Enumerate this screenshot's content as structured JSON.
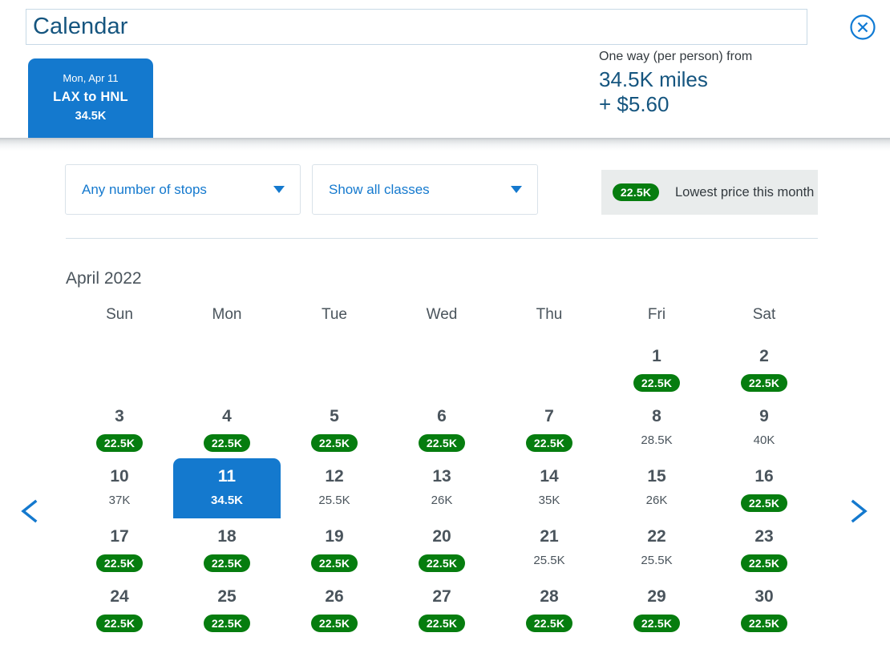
{
  "header": {
    "title": "Calendar",
    "close_icon": "close-circle-icon",
    "flight_card": {
      "date": "Mon, Apr 11",
      "route": "LAX to HNL",
      "miles": "34.5K"
    },
    "price": {
      "label": "One way (per person) from",
      "miles": "34.5K miles",
      "taxes": "+ $5.60"
    }
  },
  "filters": {
    "stops": {
      "value": "Any number of stops",
      "icon": "chevron-down-icon"
    },
    "classes": {
      "value": "Show all classes",
      "icon": "chevron-down-icon"
    },
    "legend": {
      "badge": "22.5K",
      "text": "Lowest price this month"
    }
  },
  "calendar": {
    "month": "April 2022",
    "weekdays": [
      "Sun",
      "Mon",
      "Tue",
      "Wed",
      "Thu",
      "Fri",
      "Sat"
    ],
    "prev_icon": "chevron-left-icon",
    "next_icon": "chevron-right-icon",
    "weeks": [
      [
        {
          "day": "",
          "price": "",
          "lowest": false,
          "selected": false,
          "empty": true
        },
        {
          "day": "",
          "price": "",
          "lowest": false,
          "selected": false,
          "empty": true
        },
        {
          "day": "",
          "price": "",
          "lowest": false,
          "selected": false,
          "empty": true
        },
        {
          "day": "",
          "price": "",
          "lowest": false,
          "selected": false,
          "empty": true
        },
        {
          "day": "",
          "price": "",
          "lowest": false,
          "selected": false,
          "empty": true
        },
        {
          "day": "1",
          "price": "22.5K",
          "lowest": true,
          "selected": false,
          "empty": false
        },
        {
          "day": "2",
          "price": "22.5K",
          "lowest": true,
          "selected": false,
          "empty": false
        }
      ],
      [
        {
          "day": "3",
          "price": "22.5K",
          "lowest": true,
          "selected": false,
          "empty": false
        },
        {
          "day": "4",
          "price": "22.5K",
          "lowest": true,
          "selected": false,
          "empty": false
        },
        {
          "day": "5",
          "price": "22.5K",
          "lowest": true,
          "selected": false,
          "empty": false
        },
        {
          "day": "6",
          "price": "22.5K",
          "lowest": true,
          "selected": false,
          "empty": false
        },
        {
          "day": "7",
          "price": "22.5K",
          "lowest": true,
          "selected": false,
          "empty": false
        },
        {
          "day": "8",
          "price": "28.5K",
          "lowest": false,
          "selected": false,
          "empty": false
        },
        {
          "day": "9",
          "price": "40K",
          "lowest": false,
          "selected": false,
          "empty": false
        }
      ],
      [
        {
          "day": "10",
          "price": "37K",
          "lowest": false,
          "selected": false,
          "empty": false
        },
        {
          "day": "11",
          "price": "34.5K",
          "lowest": false,
          "selected": true,
          "empty": false
        },
        {
          "day": "12",
          "price": "25.5K",
          "lowest": false,
          "selected": false,
          "empty": false
        },
        {
          "day": "13",
          "price": "26K",
          "lowest": false,
          "selected": false,
          "empty": false
        },
        {
          "day": "14",
          "price": "35K",
          "lowest": false,
          "selected": false,
          "empty": false
        },
        {
          "day": "15",
          "price": "26K",
          "lowest": false,
          "selected": false,
          "empty": false
        },
        {
          "day": "16",
          "price": "22.5K",
          "lowest": true,
          "selected": false,
          "empty": false
        }
      ],
      [
        {
          "day": "17",
          "price": "22.5K",
          "lowest": true,
          "selected": false,
          "empty": false
        },
        {
          "day": "18",
          "price": "22.5K",
          "lowest": true,
          "selected": false,
          "empty": false
        },
        {
          "day": "19",
          "price": "22.5K",
          "lowest": true,
          "selected": false,
          "empty": false
        },
        {
          "day": "20",
          "price": "22.5K",
          "lowest": true,
          "selected": false,
          "empty": false
        },
        {
          "day": "21",
          "price": "25.5K",
          "lowest": false,
          "selected": false,
          "empty": false
        },
        {
          "day": "22",
          "price": "25.5K",
          "lowest": false,
          "selected": false,
          "empty": false
        },
        {
          "day": "23",
          "price": "22.5K",
          "lowest": true,
          "selected": false,
          "empty": false
        }
      ],
      [
        {
          "day": "24",
          "price": "22.5K",
          "lowest": true,
          "selected": false,
          "empty": false
        },
        {
          "day": "25",
          "price": "22.5K",
          "lowest": true,
          "selected": false,
          "empty": false
        },
        {
          "day": "26",
          "price": "22.5K",
          "lowest": true,
          "selected": false,
          "empty": false
        },
        {
          "day": "27",
          "price": "22.5K",
          "lowest": true,
          "selected": false,
          "empty": false
        },
        {
          "day": "28",
          "price": "22.5K",
          "lowest": true,
          "selected": false,
          "empty": false
        },
        {
          "day": "29",
          "price": "22.5K",
          "lowest": true,
          "selected": false,
          "empty": false
        },
        {
          "day": "30",
          "price": "22.5K",
          "lowest": true,
          "selected": false,
          "empty": false
        }
      ]
    ]
  },
  "colors": {
    "brand_blue": "#1479ce",
    "dark_blue": "#15557f",
    "lowest_green": "#067d0f",
    "text_gray": "#4a545c"
  }
}
